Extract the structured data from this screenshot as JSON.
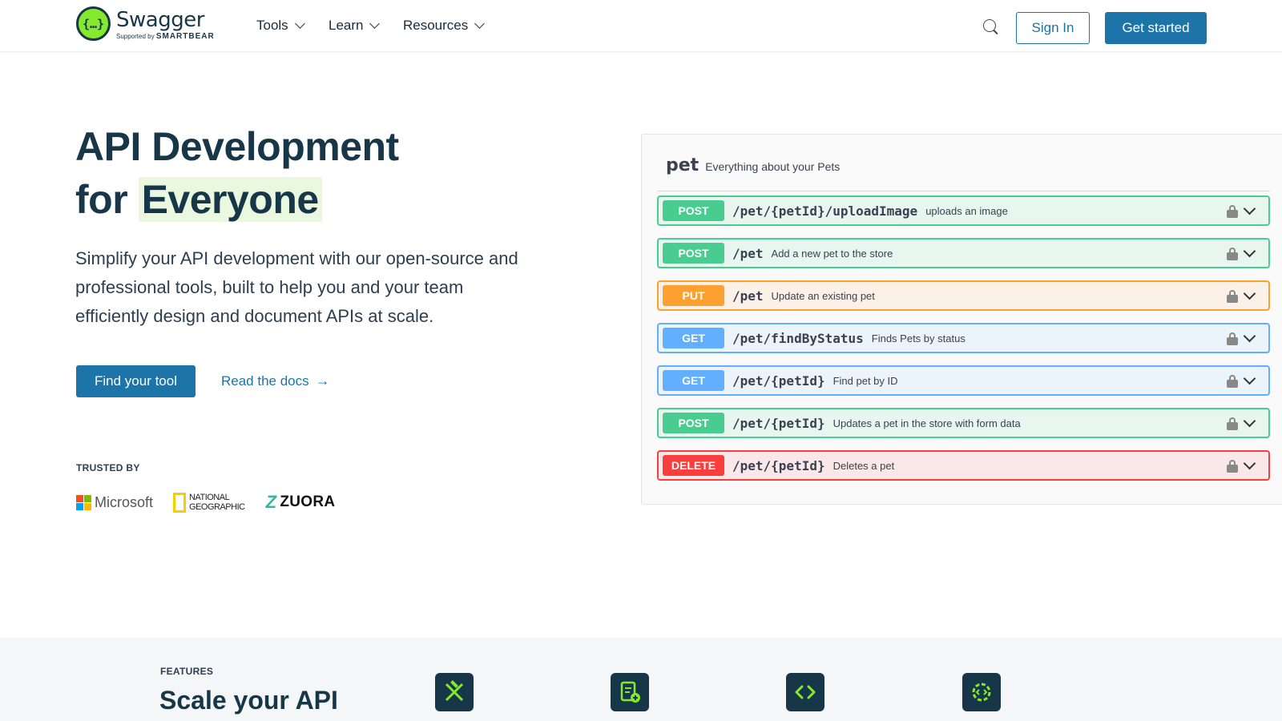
{
  "nav": {
    "logo_name": "Swagger",
    "logo_sub_prefix": "Supported by",
    "logo_sub_brand": "SMARTBEAR",
    "menus": [
      "Tools",
      "Learn",
      "Resources"
    ],
    "sign_in": "Sign In",
    "get_started": "Get started"
  },
  "hero": {
    "title_line1": "API Development",
    "title_for": "for",
    "title_highlight": "Everyone",
    "description": "Simplify your API development with our open-source and professional tools, built to help you and your team efficiently design and document APIs at scale.",
    "cta_primary": "Find your tool",
    "cta_secondary": "Read the docs",
    "cta_secondary_arrow": "→"
  },
  "trusted": {
    "label": "TRUSTED BY",
    "microsoft": "Microsoft",
    "natgeo_line1": "NATIONAL",
    "natgeo_line2": "GEOGRAPHIC",
    "zuora": "ZUORA"
  },
  "api_panel": {
    "tag": "pet",
    "tag_description": "Everything about your Pets",
    "operations": [
      {
        "method": "POST",
        "path": "/pet/{petId}/uploadImage",
        "summary": "uploads an image"
      },
      {
        "method": "POST",
        "path": "/pet",
        "summary": "Add a new pet to the store"
      },
      {
        "method": "PUT",
        "path": "/pet",
        "summary": "Update an existing pet"
      },
      {
        "method": "GET",
        "path": "/pet/findByStatus",
        "summary": "Finds Pets by status"
      },
      {
        "method": "GET",
        "path": "/pet/{petId}",
        "summary": "Find pet by ID"
      },
      {
        "method": "POST",
        "path": "/pet/{petId}",
        "summary": "Updates a pet in the store with form data"
      },
      {
        "method": "DELETE",
        "path": "/pet/{petId}",
        "summary": "Deletes a pet"
      }
    ]
  },
  "features": {
    "label": "FEATURES",
    "title": "Scale your API",
    "icons": [
      "design-tools-icon",
      "document-add-icon",
      "code-brackets-icon",
      "gear-code-icon"
    ]
  },
  "colors": {
    "brand_blue": "#1d74a8",
    "navy": "#173647",
    "swagger_green": "#85ea2d",
    "post": "#49cc90",
    "put": "#fca130",
    "get": "#61affe",
    "delete": "#f93e3e"
  }
}
